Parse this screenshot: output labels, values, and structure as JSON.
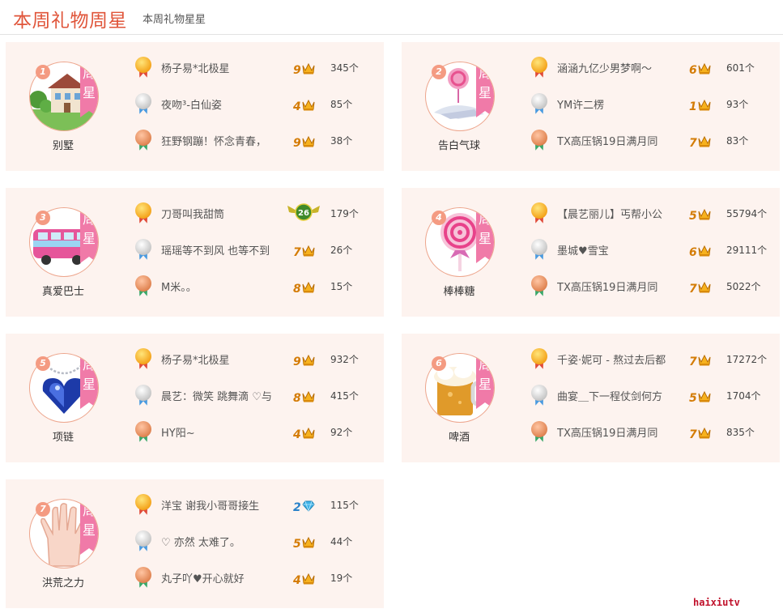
{
  "header": {
    "title": "本周礼物周星",
    "subtitle": "本周礼物星星"
  },
  "ribbon_text": "周星",
  "colors": {
    "accent": "#e0553a",
    "card_bg": "#fdf3ef",
    "ribbon": "#f07aa8",
    "rank_badge": "#f49b82"
  },
  "cards": [
    {
      "rank": "1",
      "gift": "别墅",
      "icon": "villa-icon",
      "rows": [
        {
          "medal": "gold",
          "name": "杨子易*北极星",
          "level": "9",
          "level_type": "crown",
          "count": "345个"
        },
        {
          "medal": "silver",
          "name": "夜吻³-白仙姿",
          "level": "4",
          "level_type": "crown",
          "count": "85个"
        },
        {
          "medal": "bronze",
          "name": "狂野钢蹦！怀念青春，",
          "level": "9",
          "level_type": "crown",
          "count": "38个"
        }
      ]
    },
    {
      "rank": "2",
      "gift": "告白气球",
      "icon": "balloon-icon",
      "rows": [
        {
          "medal": "gold",
          "name": "涵涵九亿少男梦啊～",
          "level": "6",
          "level_type": "crown",
          "count": "601个"
        },
        {
          "medal": "silver",
          "name": "YM许二楞",
          "level": "1",
          "level_type": "crown",
          "count": "93个"
        },
        {
          "medal": "bronze",
          "name": "TX高压锅19日满月同",
          "level": "7",
          "level_type": "crown",
          "count": "83个"
        }
      ]
    },
    {
      "rank": "3",
      "gift": "真爱巴士",
      "icon": "bus-icon",
      "rows": [
        {
          "medal": "gold",
          "name": "刀哥叫我甜筒",
          "level": "26",
          "level_type": "wing",
          "count": "179个"
        },
        {
          "medal": "silver",
          "name": "瑶瑶等不到风 也等不到",
          "level": "7",
          "level_type": "crown",
          "count": "26个"
        },
        {
          "medal": "bronze",
          "name": "M米。。",
          "level": "8",
          "level_type": "crown",
          "count": "15个"
        }
      ]
    },
    {
      "rank": "4",
      "gift": "棒棒糖",
      "icon": "lollipop-icon",
      "rows": [
        {
          "medal": "gold",
          "name": "【晨艺丽儿】丐帮小公",
          "level": "5",
          "level_type": "crown",
          "count": "55794个"
        },
        {
          "medal": "silver",
          "name": "墨城♥雪宝",
          "level": "6",
          "level_type": "crown",
          "count": "29111个"
        },
        {
          "medal": "bronze",
          "name": "TX高压锅19日满月同",
          "level": "7",
          "level_type": "crown",
          "count": "5022个"
        }
      ]
    },
    {
      "rank": "5",
      "gift": "项链",
      "icon": "necklace-icon",
      "rows": [
        {
          "medal": "gold",
          "name": "杨子易*北极星",
          "level": "9",
          "level_type": "crown",
          "count": "932个"
        },
        {
          "medal": "silver",
          "name": "晨艺：微笑 跳舞滴 ♡与",
          "level": "8",
          "level_type": "crown",
          "count": "415个"
        },
        {
          "medal": "bronze",
          "name": "HY阳~",
          "level": "4",
          "level_type": "crown",
          "count": "92个"
        }
      ]
    },
    {
      "rank": "6",
      "gift": "啤酒",
      "icon": "beer-icon",
      "rows": [
        {
          "medal": "gold",
          "name": "千姿·妮可 - 熬过去后都",
          "level": "7",
          "level_type": "crown",
          "count": "17272个"
        },
        {
          "medal": "silver",
          "name": "曲宴＿下一程仗剑何方",
          "level": "5",
          "level_type": "crown",
          "count": "1704个"
        },
        {
          "medal": "bronze",
          "name": "TX高压锅19日满月同",
          "level": "7",
          "level_type": "crown",
          "count": "835个"
        }
      ]
    },
    {
      "rank": "7",
      "gift": "洪荒之力",
      "icon": "hand-icon",
      "rows": [
        {
          "medal": "gold",
          "name": "洋宝 谢我小哥哥接生",
          "level": "2",
          "level_type": "diamond",
          "count": "115个"
        },
        {
          "medal": "silver",
          "name": "♡ 亦然 太难了。",
          "level": "5",
          "level_type": "crown",
          "count": "44个"
        },
        {
          "medal": "bronze",
          "name": "丸子吖♥开心就好",
          "level": "4",
          "level_type": "crown",
          "count": "19个"
        }
      ]
    }
  ],
  "watermark": "haixiutv"
}
